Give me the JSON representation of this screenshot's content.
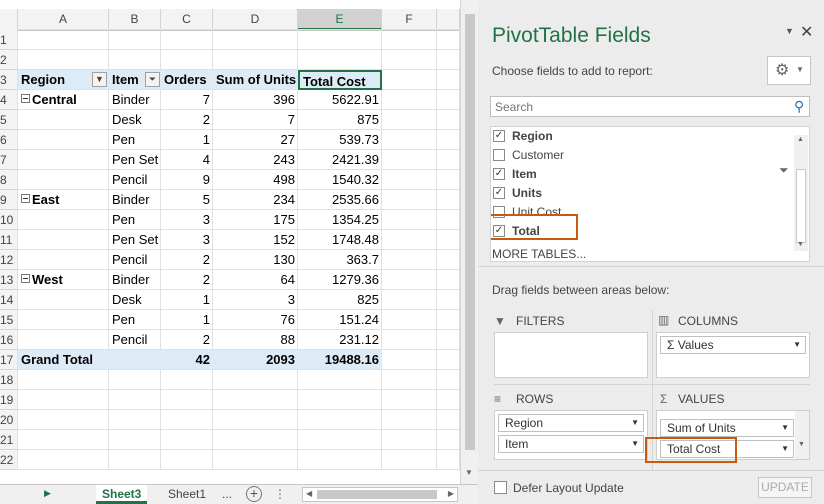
{
  "sheet": {
    "columns": [
      "A",
      "B",
      "C",
      "D",
      "E",
      "F",
      ""
    ],
    "rows": [
      "1",
      "2",
      "3",
      "4",
      "5",
      "6",
      "7",
      "8",
      "9",
      "10",
      "11",
      "12",
      "13",
      "14",
      "15",
      "16",
      "17",
      "18",
      "19",
      "20",
      "21",
      "22"
    ],
    "header": {
      "region": "Region",
      "item": "Item",
      "orders": "Orders",
      "units": "Sum of Units",
      "cost": "Total Cost"
    },
    "data": [
      {
        "region": "Central",
        "item": "Binder",
        "orders": "7",
        "units": "396",
        "cost": "5622.91"
      },
      {
        "region": "",
        "item": "Desk",
        "orders": "2",
        "units": "7",
        "cost": "875"
      },
      {
        "region": "",
        "item": "Pen",
        "orders": "1",
        "units": "27",
        "cost": "539.73"
      },
      {
        "region": "",
        "item": "Pen Set",
        "orders": "4",
        "units": "243",
        "cost": "2421.39"
      },
      {
        "region": "",
        "item": "Pencil",
        "orders": "9",
        "units": "498",
        "cost": "1540.32"
      },
      {
        "region": "East",
        "item": "Binder",
        "orders": "5",
        "units": "234",
        "cost": "2535.66"
      },
      {
        "region": "",
        "item": "Pen",
        "orders": "3",
        "units": "175",
        "cost": "1354.25"
      },
      {
        "region": "",
        "item": "Pen Set",
        "orders": "3",
        "units": "152",
        "cost": "1748.48"
      },
      {
        "region": "",
        "item": "Pencil",
        "orders": "2",
        "units": "130",
        "cost": "363.7"
      },
      {
        "region": "West",
        "item": "Binder",
        "orders": "2",
        "units": "64",
        "cost": "1279.36"
      },
      {
        "region": "",
        "item": "Desk",
        "orders": "1",
        "units": "3",
        "cost": "825"
      },
      {
        "region": "",
        "item": "Pen",
        "orders": "1",
        "units": "76",
        "cost": "151.24"
      },
      {
        "region": "",
        "item": "Pencil",
        "orders": "2",
        "units": "88",
        "cost": "231.12"
      }
    ],
    "grand": {
      "label": "Grand Total",
      "orders": "42",
      "units": "2093",
      "cost": "19488.16"
    },
    "tabs": {
      "active": "Sheet3",
      "other": "Sheet1",
      "more": "..."
    }
  },
  "pane": {
    "title": "PivotTable Fields",
    "choose": "Choose fields to add to report:",
    "search_placeholder": "Search",
    "fields": [
      {
        "label": "Region",
        "checked": true
      },
      {
        "label": "Customer",
        "checked": false
      },
      {
        "label": "Item",
        "checked": true
      },
      {
        "label": "Units",
        "checked": true
      },
      {
        "label": "Unit Cost",
        "checked": false
      },
      {
        "label": "Total",
        "checked": true
      }
    ],
    "more_tables": "MORE TABLES...",
    "drag": "Drag fields between areas below:",
    "filters": "FILTERS",
    "columns": "COLUMNS",
    "rows": "ROWS",
    "values": "VALUES",
    "columns_items": [
      "Values"
    ],
    "rows_items": [
      "Region",
      "Item"
    ],
    "values_items": [
      "Sum of Units",
      "Total Cost"
    ],
    "defer": "Defer Layout Update",
    "update": "UPDATE"
  }
}
